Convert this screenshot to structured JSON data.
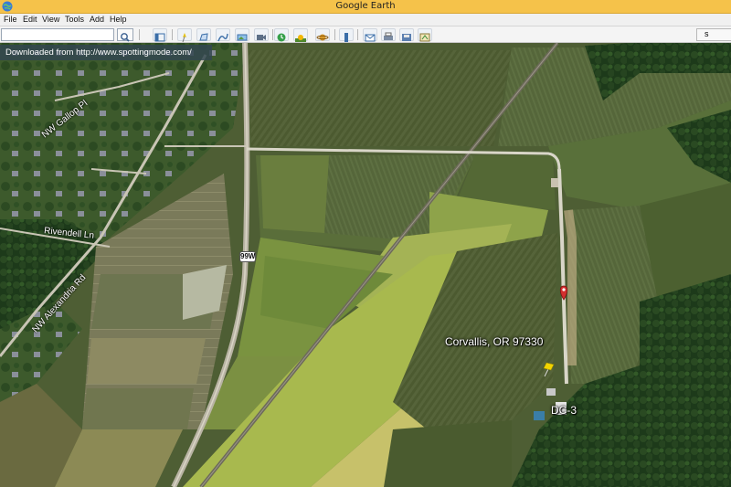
{
  "window": {
    "title": "Google Earth"
  },
  "menu": [
    "File",
    "Edit",
    "View",
    "Tools",
    "Add",
    "Help"
  ],
  "search": {
    "placeholder": "",
    "value": ""
  },
  "toolbar": {
    "right_button_label": "s"
  },
  "watermark": "Downloaded from http://www.spottingmode.com/",
  "map": {
    "road_labels": [
      "NW Gallop Pl",
      "Rivendell Ln",
      "NW Alexandria Rd"
    ],
    "highway_shield": "99W",
    "place_label": "Corvallis, OR 97330",
    "pin_label": "DC-3"
  },
  "colors": {
    "titlebar": "#f5c24a",
    "place_marker": "#d32f2f",
    "pushpin": "#f2d400"
  },
  "icons": [
    "globe-icon",
    "search-icon",
    "sidebar-icon",
    "placemark-icon",
    "polygon-icon",
    "path-icon",
    "overlay-icon",
    "tour-icon",
    "historical-imagery-icon",
    "sunlight-icon",
    "planets-icon",
    "ruler-icon",
    "email-icon",
    "print-icon",
    "save-image-icon"
  ]
}
